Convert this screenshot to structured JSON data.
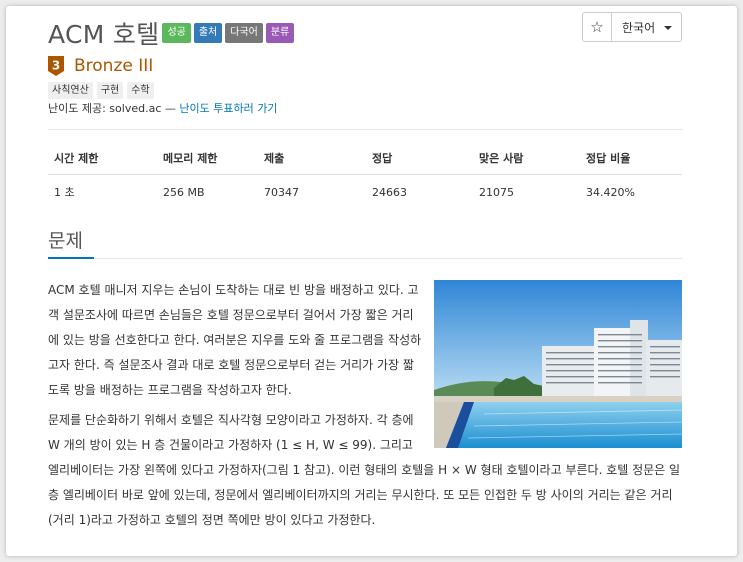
{
  "problem": {
    "title": "ACM 호텔",
    "tags": [
      {
        "label": "성공",
        "color": "#5cb85c"
      },
      {
        "label": "출처",
        "color": "#337ab7"
      },
      {
        "label": "다국어",
        "color": "#777777"
      },
      {
        "label": "분류",
        "color": "#9b59b6"
      }
    ],
    "tier": {
      "number": "3",
      "label": "Bronze III",
      "color": "#ad5600"
    },
    "algorithms": [
      "사칙연산",
      "구현",
      "수학"
    ],
    "credit_prefix": "난이도 제공: solved.ac — ",
    "credit_link": "난이도 투표하러 가기"
  },
  "toolbar": {
    "star_glyph": "☆",
    "language": "한국어"
  },
  "info_table": {
    "headers": [
      "시간 제한",
      "메모리 제한",
      "제출",
      "정답",
      "맞은 사람",
      "정답 비율"
    ],
    "row": [
      "1 초",
      "256 MB",
      "70347",
      "24663",
      "21075",
      "34.420%"
    ]
  },
  "section": {
    "title": "문제"
  },
  "description": {
    "paragraphs": [
      "ACM 호텔 매니저 지우는 손님이 도착하는 대로 빈 방을 배정하고 있다. 고객 설문조사에 따르면 손님들은 호텔 정문으로부터 걸어서 가장 짧은 거리에 있는 방을 선호한다고 한다. 여러분은 지우를 도와 줄 프로그램을 작성하고자 한다. 즉 설문조사 결과 대로 호텔 정문으로부터 걷는 거리가 가장 짧도록 방을 배정하는 프로그램을 작성하고자 한다.",
      "문제를 단순화하기 위해서 호텔은 직사각형 모양이라고 가정하자. 각 층에 W 개의 방이 있는 H 층 건물이라고 가정하자 (1 ≤ H, W ≤ 99). 그리고 엘리베이터는 가장 왼쪽에 있다고 가정하자(그림 1 참고). 이런 형태의 호텔을 H × W 형태 호텔이라고 부른다. 호텔 정문은 일층 엘리베이터 바로 앞에 있는데, 정문에서 엘리베이터까지의 거리는 무시한다. 또 모든 인접한 두 방 사이의 거리는 같은 거리(거리 1)라고 가정하고 호텔의 정면 쪽에만 방이 있다고 가정한다."
    ]
  }
}
